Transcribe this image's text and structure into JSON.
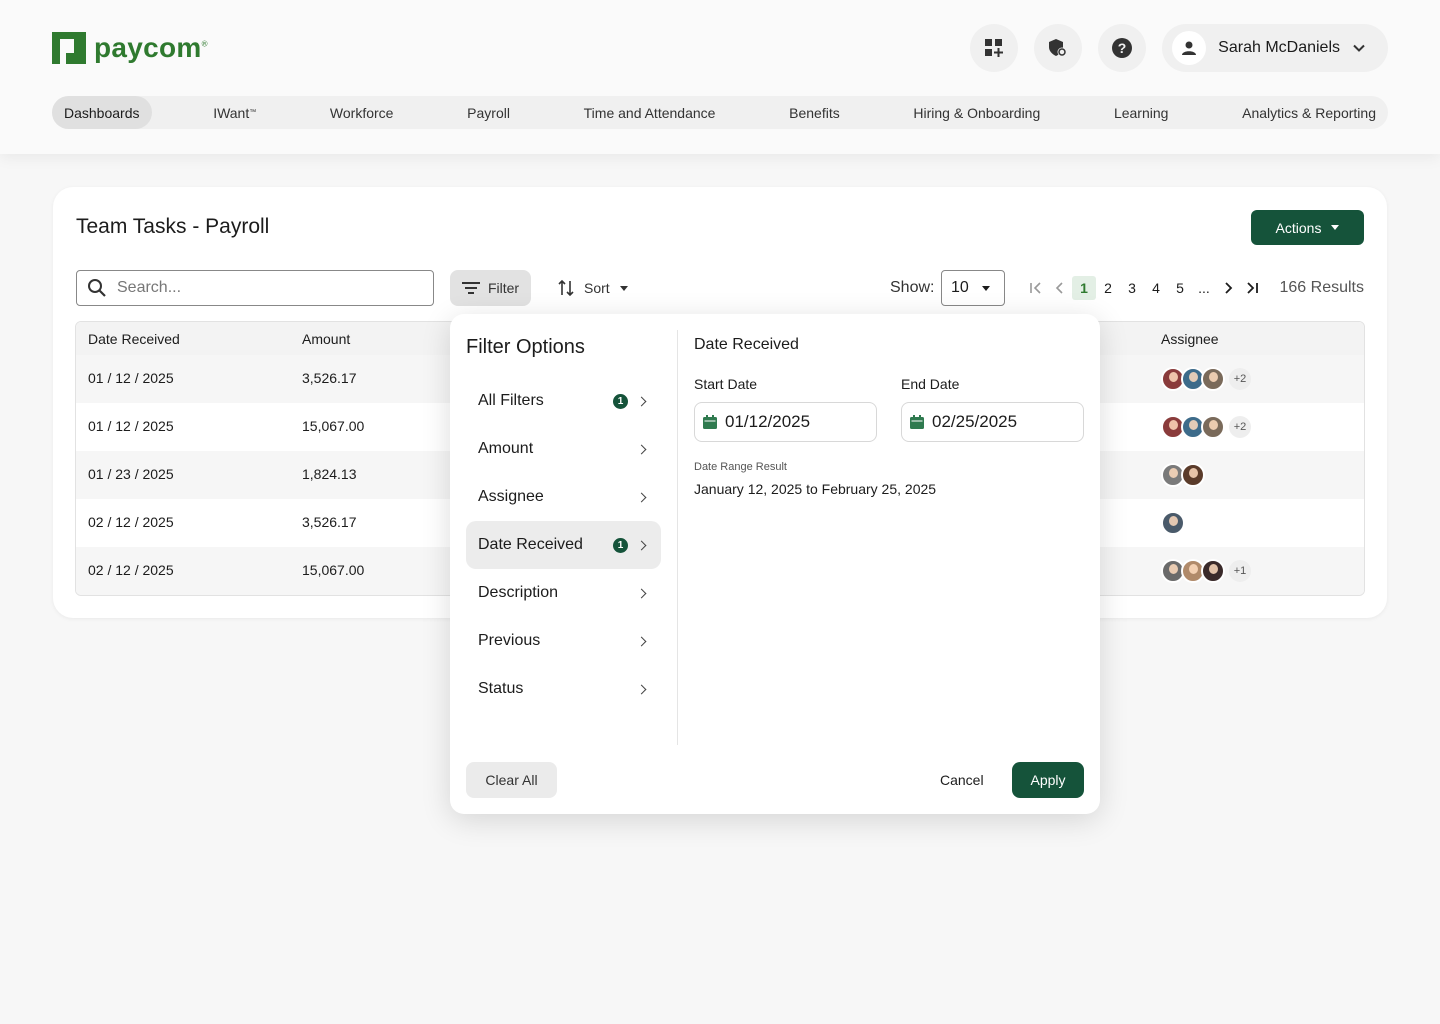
{
  "brand": {
    "name": "paycom",
    "mark": "®",
    "color": "#2f7a2f"
  },
  "header": {
    "icons": [
      "apps-add-icon",
      "shield-settings-icon",
      "help-icon"
    ],
    "user": {
      "name": "Sarah McDaniels"
    }
  },
  "nav": {
    "items": [
      {
        "label": "Dashboards",
        "active": true
      },
      {
        "label": "IWant",
        "sup": "™"
      },
      {
        "label": "Workforce"
      },
      {
        "label": "Payroll"
      },
      {
        "label": "Time and Attendance"
      },
      {
        "label": "Benefits"
      },
      {
        "label": "Hiring & Onboarding"
      },
      {
        "label": "Learning"
      },
      {
        "label": "Analytics & Reporting"
      }
    ]
  },
  "card": {
    "title": "Team Tasks - Payroll",
    "actions_label": "Actions",
    "search_placeholder": "Search...",
    "filter_label": "Filter",
    "sort_label": "Sort",
    "show_label": "Show:",
    "show_value": "10",
    "pages": [
      "1",
      "2",
      "3",
      "4",
      "5",
      "..."
    ],
    "current_page": "1",
    "results": "166 Results",
    "columns": {
      "date": "Date Received",
      "amount": "Amount",
      "assignee": "Assignee"
    },
    "rows": [
      {
        "date": "01 / 12 / 2025",
        "amount": "3,526.17",
        "avatars": [
          "#8a3b3b",
          "#3d6b8a",
          "#7a6a5a"
        ],
        "more": "+2"
      },
      {
        "date": "01 / 12 / 2025",
        "amount": "15,067.00",
        "avatars": [
          "#8a3b3b",
          "#3d6b8a",
          "#7a6a5a"
        ],
        "more": "+2"
      },
      {
        "date": "01 / 23 / 2025",
        "amount": "1,824.13",
        "avatars": [
          "#7a7a7a",
          "#5a3b2a"
        ],
        "more": ""
      },
      {
        "date": "02 / 12 / 2025",
        "amount": "3,526.17",
        "avatars": [
          "#4a5a6a"
        ],
        "more": ""
      },
      {
        "date": "02 / 12 / 2025",
        "amount": "15,067.00",
        "avatars": [
          "#6a6a6a",
          "#b08a6a",
          "#3a2a2a"
        ],
        "more": "+1"
      }
    ]
  },
  "filter": {
    "title": "Filter Options",
    "options": [
      {
        "label": "All Filters",
        "badge": "1"
      },
      {
        "label": "Amount",
        "badge": ""
      },
      {
        "label": "Assignee",
        "badge": ""
      },
      {
        "label": "Date Received",
        "badge": "1",
        "active": true
      },
      {
        "label": "Description",
        "badge": ""
      },
      {
        "label": "Previous",
        "badge": ""
      },
      {
        "label": "Status",
        "badge": ""
      }
    ],
    "section_title": "Date Received",
    "start_label": "Start Date",
    "start_value": "01/12/2025",
    "end_label": "End Date",
    "end_value": "02/25/2025",
    "range_label": "Date Range Result",
    "range_value": "January 12, 2025 to February 25, 2025",
    "clear_label": "Clear All",
    "cancel_label": "Cancel",
    "apply_label": "Apply"
  },
  "colors": {
    "primary": "#15533a",
    "accent_light": "#e3efe5"
  }
}
